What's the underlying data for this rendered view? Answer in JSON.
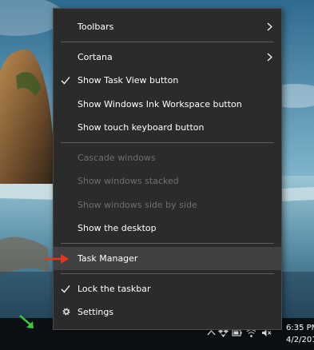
{
  "context_menu": {
    "items": [
      {
        "label": "Toolbars",
        "submenu": true
      },
      {
        "label": "Cortana",
        "submenu": true
      },
      {
        "label": "Show Task View button",
        "checked": true
      },
      {
        "label": "Show Windows Ink Workspace button"
      },
      {
        "label": "Show touch keyboard button"
      },
      {
        "label": "Cascade windows",
        "disabled": true
      },
      {
        "label": "Show windows stacked",
        "disabled": true
      },
      {
        "label": "Show windows side by side",
        "disabled": true
      },
      {
        "label": "Show the desktop"
      },
      {
        "label": "Task Manager",
        "highlighted": true
      },
      {
        "label": "Lock the taskbar",
        "checked": true
      },
      {
        "label": "Settings",
        "icon": "gear-icon"
      }
    ]
  },
  "taskbar": {
    "time": "6:35 PM",
    "date": "4/2/201",
    "tray_icons": [
      "chevron-up-icon",
      "dropbox-icon",
      "battery-icon",
      "wifi-icon",
      "volume-muted-icon"
    ]
  },
  "annotations": {
    "red_arrow_color": "#e8351f",
    "green_arrow_color": "#3cc43c"
  },
  "colors": {
    "menu_bg": "#2b2b2b",
    "menu_text": "#ffffff",
    "menu_text_disabled": "#6f6f6f",
    "menu_highlight": "#414141",
    "separator": "#5d5d5d",
    "taskbar_bg": "#0c0f14"
  }
}
